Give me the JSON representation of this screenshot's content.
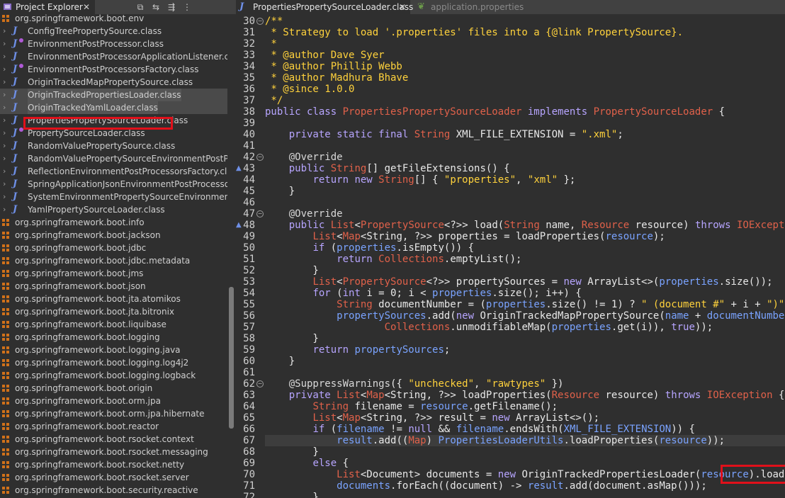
{
  "explorer": {
    "tab_label": "Project Explorer",
    "tab_close": "✕",
    "toolbar": [
      "⧉",
      "⇆",
      "⇶",
      "⋮"
    ],
    "rows": [
      {
        "kind": "pkg-cut",
        "label": "org.springframework.boot.env"
      },
      {
        "kind": "class",
        "label": "ConfigTreePropertySource.class"
      },
      {
        "kind": "class",
        "label": "EnvironmentPostProcessor.class",
        "overlay": true
      },
      {
        "kind": "class",
        "label": "EnvironmentPostProcessorApplicationListener.class"
      },
      {
        "kind": "class",
        "label": "EnvironmentPostProcessorsFactory.class",
        "overlay": true
      },
      {
        "kind": "class",
        "label": "OriginTrackedMapPropertySource.class"
      },
      {
        "kind": "class",
        "label": "OriginTrackedPropertiesLoader.class",
        "selected": true
      },
      {
        "kind": "class",
        "label": "OriginTrackedYamlLoader.class",
        "selected": true
      },
      {
        "kind": "class",
        "label": "PropertiesPropertySourceLoader.class"
      },
      {
        "kind": "class",
        "label": "PropertySourceLoader.class",
        "overlay": true
      },
      {
        "kind": "class",
        "label": "RandomValuePropertySource.class"
      },
      {
        "kind": "class",
        "label": "RandomValuePropertySourceEnvironmentPostProce"
      },
      {
        "kind": "class",
        "label": "ReflectionEnvironmentPostProcessorsFactory.class"
      },
      {
        "kind": "class",
        "label": "SpringApplicationJsonEnvironmentPostProcessor.cla"
      },
      {
        "kind": "class",
        "label": "SystemEnvironmentPropertySourceEnvironmentPost"
      },
      {
        "kind": "class",
        "label": "YamlPropertySourceLoader.class"
      },
      {
        "kind": "pkg",
        "label": "org.springframework.boot.info"
      },
      {
        "kind": "pkg",
        "label": "org.springframework.boot.jackson"
      },
      {
        "kind": "pkg",
        "label": "org.springframework.boot.jdbc"
      },
      {
        "kind": "pkg",
        "label": "org.springframework.boot.jdbc.metadata"
      },
      {
        "kind": "pkg",
        "label": "org.springframework.boot.jms"
      },
      {
        "kind": "pkg",
        "label": "org.springframework.boot.json"
      },
      {
        "kind": "pkg",
        "label": "org.springframework.boot.jta.atomikos"
      },
      {
        "kind": "pkg",
        "label": "org.springframework.boot.jta.bitronix"
      },
      {
        "kind": "pkg",
        "label": "org.springframework.boot.liquibase"
      },
      {
        "kind": "pkg",
        "label": "org.springframework.boot.logging"
      },
      {
        "kind": "pkg",
        "label": "org.springframework.boot.logging.java"
      },
      {
        "kind": "pkg",
        "label": "org.springframework.boot.logging.log4j2"
      },
      {
        "kind": "pkg",
        "label": "org.springframework.boot.logging.logback"
      },
      {
        "kind": "pkg",
        "label": "org.springframework.boot.origin"
      },
      {
        "kind": "pkg",
        "label": "org.springframework.boot.orm.jpa"
      },
      {
        "kind": "pkg",
        "label": "org.springframework.boot.orm.jpa.hibernate"
      },
      {
        "kind": "pkg",
        "label": "org.springframework.boot.reactor"
      },
      {
        "kind": "pkg",
        "label": "org.springframework.boot.rsocket.context"
      },
      {
        "kind": "pkg",
        "label": "org.springframework.boot.rsocket.messaging"
      },
      {
        "kind": "pkg",
        "label": "org.springframework.boot.rsocket.netty"
      },
      {
        "kind": "pkg",
        "label": "org.springframework.boot.rsocket.server"
      },
      {
        "kind": "pkg",
        "label": "org.springframework.boot.security.reactive"
      }
    ]
  },
  "editor": {
    "tabs": [
      {
        "label": "PropertiesPropertySourceLoader.class",
        "close": "✕",
        "icon": "J"
      },
      {
        "label": "application.properties",
        "icon": "❦"
      }
    ],
    "lines": [
      {
        "n": "30",
        "fold": "−",
        "segs": [
          [
            "c",
            "/**"
          ]
        ]
      },
      {
        "n": "31",
        "segs": [
          [
            "c",
            " * Strategy to load '.properties' files into a {@link PropertySource}."
          ]
        ]
      },
      {
        "n": "32",
        "segs": [
          [
            "c",
            " *"
          ]
        ]
      },
      {
        "n": "33",
        "segs": [
          [
            "c",
            " * @author Dave Syer"
          ]
        ]
      },
      {
        "n": "34",
        "segs": [
          [
            "c",
            " * @author Phillip Webb"
          ]
        ]
      },
      {
        "n": "35",
        "segs": [
          [
            "c",
            " * @author Madhura Bhave"
          ]
        ]
      },
      {
        "n": "36",
        "segs": [
          [
            "c",
            " * @since 1.0.0"
          ]
        ]
      },
      {
        "n": "37",
        "segs": [
          [
            "c",
            " */"
          ]
        ]
      },
      {
        "n": "38",
        "segs": [
          [
            "kw",
            "public class "
          ],
          [
            "t",
            "PropertiesPropertySourceLoader"
          ],
          [
            "kw",
            " implements "
          ],
          [
            "t",
            "PropertySourceLoader"
          ],
          [
            "a",
            " {"
          ]
        ]
      },
      {
        "n": "39",
        "segs": []
      },
      {
        "n": "40",
        "segs": [
          [
            "a",
            "    "
          ],
          [
            "kw",
            "private static final "
          ],
          [
            "t",
            "String"
          ],
          [
            "a",
            " XML_FILE_EXTENSION = "
          ],
          [
            "s",
            "\".xml\""
          ],
          [
            "a",
            ";"
          ]
        ]
      },
      {
        "n": "41",
        "segs": []
      },
      {
        "n": "42",
        "fold": "−",
        "segs": [
          [
            "a",
            "    "
          ],
          [
            "an",
            "@Override"
          ]
        ]
      },
      {
        "n": "43",
        "ovr": true,
        "segs": [
          [
            "a",
            "    "
          ],
          [
            "kw",
            "public "
          ],
          [
            "t",
            "String"
          ],
          [
            "a",
            "[] getFileExtensions() {"
          ]
        ]
      },
      {
        "n": "44",
        "segs": [
          [
            "a",
            "        "
          ],
          [
            "kw",
            "return new "
          ],
          [
            "t",
            "String"
          ],
          [
            "a",
            "[] { "
          ],
          [
            "s",
            "\"properties\""
          ],
          [
            "a",
            ", "
          ],
          [
            "s",
            "\"xml\""
          ],
          [
            "a",
            " };"
          ]
        ]
      },
      {
        "n": "45",
        "segs": [
          [
            "a",
            "    }"
          ]
        ]
      },
      {
        "n": "46",
        "segs": []
      },
      {
        "n": "47",
        "fold": "−",
        "segs": [
          [
            "a",
            "    "
          ],
          [
            "an",
            "@Override"
          ]
        ]
      },
      {
        "n": "48",
        "ovr": true,
        "segs": [
          [
            "a",
            "    "
          ],
          [
            "kw",
            "public "
          ],
          [
            "t",
            "List"
          ],
          [
            "a",
            "<"
          ],
          [
            "t",
            "PropertySource"
          ],
          [
            "a",
            "<?>> load("
          ],
          [
            "t",
            "String"
          ],
          [
            "a",
            " name, "
          ],
          [
            "t",
            "Resource"
          ],
          [
            "a",
            " resource) "
          ],
          [
            "kw",
            "throws "
          ],
          [
            "t",
            "IOException"
          ],
          [
            "a",
            " {"
          ]
        ]
      },
      {
        "n": "49",
        "segs": [
          [
            "a",
            "        "
          ],
          [
            "t",
            "List"
          ],
          [
            "a",
            "<"
          ],
          [
            "t",
            "Map"
          ],
          [
            "a",
            "<String, ?>> properties = loadProperties("
          ],
          [
            "v",
            "resource"
          ],
          [
            "a",
            ");"
          ]
        ]
      },
      {
        "n": "50",
        "segs": [
          [
            "a",
            "        "
          ],
          [
            "kw",
            "if "
          ],
          [
            "a",
            "("
          ],
          [
            "v",
            "properties"
          ],
          [
            "a",
            ".isEmpty()) {"
          ]
        ]
      },
      {
        "n": "51",
        "segs": [
          [
            "a",
            "            "
          ],
          [
            "kw",
            "return "
          ],
          [
            "t",
            "Collections"
          ],
          [
            "a",
            ".emptyList();"
          ]
        ]
      },
      {
        "n": "52",
        "segs": [
          [
            "a",
            "        }"
          ]
        ]
      },
      {
        "n": "53",
        "segs": [
          [
            "a",
            "        "
          ],
          [
            "t",
            "List"
          ],
          [
            "a",
            "<"
          ],
          [
            "t",
            "PropertySource"
          ],
          [
            "a",
            "<?>> propertySources = "
          ],
          [
            "kw",
            "new "
          ],
          [
            "a",
            "ArrayList<>("
          ],
          [
            "v",
            "properties"
          ],
          [
            "a",
            ".size());"
          ]
        ]
      },
      {
        "n": "54",
        "segs": [
          [
            "a",
            "        "
          ],
          [
            "kw",
            "for "
          ],
          [
            "a",
            "("
          ],
          [
            "kw",
            "int "
          ],
          [
            "a",
            "i = 0; i < "
          ],
          [
            "v",
            "properties"
          ],
          [
            "a",
            ".size(); i++) {"
          ]
        ]
      },
      {
        "n": "55",
        "segs": [
          [
            "a",
            "            "
          ],
          [
            "t",
            "String"
          ],
          [
            "a",
            " documentNumber = ("
          ],
          [
            "v",
            "properties"
          ],
          [
            "a",
            ".size() != 1) ? "
          ],
          [
            "s",
            "\" (document #\""
          ],
          [
            "a",
            " + i + "
          ],
          [
            "s",
            "\")\""
          ],
          [
            "a",
            " : "
          ],
          [
            "s",
            "\"\""
          ]
        ]
      },
      {
        "n": "56",
        "segs": [
          [
            "a",
            "            "
          ],
          [
            "v",
            "propertySources"
          ],
          [
            "a",
            ".add("
          ],
          [
            "kw",
            "new "
          ],
          [
            "a",
            "OriginTrackedMapPropertySource("
          ],
          [
            "v",
            "name"
          ],
          [
            "a",
            " + "
          ],
          [
            "v",
            "documentNumber"
          ],
          [
            "a",
            ","
          ]
        ]
      },
      {
        "n": "57",
        "segs": [
          [
            "a",
            "                    "
          ],
          [
            "t",
            "Collections"
          ],
          [
            "a",
            ".unmodifiableMap("
          ],
          [
            "v",
            "properties"
          ],
          [
            "a",
            ".get(i)), "
          ],
          [
            "kw",
            "true"
          ],
          [
            "a",
            "));"
          ]
        ]
      },
      {
        "n": "58",
        "segs": [
          [
            "a",
            "        }"
          ]
        ]
      },
      {
        "n": "59",
        "segs": [
          [
            "a",
            "        "
          ],
          [
            "kw",
            "return "
          ],
          [
            "v",
            "propertySources"
          ],
          [
            "a",
            ";"
          ]
        ]
      },
      {
        "n": "60",
        "segs": [
          [
            "a",
            "    }"
          ]
        ]
      },
      {
        "n": "61",
        "segs": []
      },
      {
        "n": "62",
        "fold": "−",
        "segs": [
          [
            "a",
            "    "
          ],
          [
            "an",
            "@SuppressWarnings"
          ],
          [
            "a",
            "({ "
          ],
          [
            "s",
            "\"unchecked\""
          ],
          [
            "a",
            ", "
          ],
          [
            "s",
            "\"rawtypes\""
          ],
          [
            "a",
            " })"
          ]
        ]
      },
      {
        "n": "63",
        "segs": [
          [
            "a",
            "    "
          ],
          [
            "kw",
            "private "
          ],
          [
            "t",
            "List"
          ],
          [
            "a",
            "<"
          ],
          [
            "t",
            "Map"
          ],
          [
            "a",
            "<String, ?>> loadProperties("
          ],
          [
            "t",
            "Resource"
          ],
          [
            "a",
            " resource) "
          ],
          [
            "kw",
            "throws "
          ],
          [
            "t",
            "IOException"
          ],
          [
            "a",
            " {"
          ]
        ]
      },
      {
        "n": "64",
        "segs": [
          [
            "a",
            "        "
          ],
          [
            "t",
            "String"
          ],
          [
            "a",
            " filename = "
          ],
          [
            "v",
            "resource"
          ],
          [
            "a",
            ".getFilename();"
          ]
        ]
      },
      {
        "n": "65",
        "segs": [
          [
            "a",
            "        "
          ],
          [
            "t",
            "List"
          ],
          [
            "a",
            "<"
          ],
          [
            "t",
            "Map"
          ],
          [
            "a",
            "<String, ?>> result = "
          ],
          [
            "kw",
            "new "
          ],
          [
            "a",
            "ArrayList<>();"
          ]
        ]
      },
      {
        "n": "66",
        "segs": [
          [
            "a",
            "        "
          ],
          [
            "kw",
            "if "
          ],
          [
            "a",
            "("
          ],
          [
            "v",
            "filename"
          ],
          [
            "a",
            " != "
          ],
          [
            "kw",
            "null "
          ],
          [
            "a",
            "&& "
          ],
          [
            "v",
            "filename"
          ],
          [
            "a",
            ".endsWith("
          ],
          [
            "v",
            "XML_FILE_EXTENSION"
          ],
          [
            "a",
            ")) {"
          ]
        ]
      },
      {
        "n": "67",
        "cur": true,
        "segs": [
          [
            "a",
            "            "
          ],
          [
            "v",
            "result"
          ],
          [
            "a",
            ".add(("
          ],
          [
            "t",
            "Map"
          ],
          [
            "a",
            ") "
          ],
          [
            "v",
            "PropertiesLoaderUtils"
          ],
          [
            "a",
            ".loadProperties("
          ],
          [
            "v",
            "resource"
          ],
          [
            "a",
            "));"
          ]
        ]
      },
      {
        "n": "68",
        "segs": [
          [
            "a",
            "        }"
          ]
        ]
      },
      {
        "n": "69",
        "segs": [
          [
            "a",
            "        "
          ],
          [
            "kw",
            "else "
          ],
          [
            "a",
            "{"
          ]
        ]
      },
      {
        "n": "70",
        "segs": [
          [
            "a",
            "            "
          ],
          [
            "t",
            "List"
          ],
          [
            "a",
            "<Document> documents = "
          ],
          [
            "kw",
            "new "
          ],
          [
            "a",
            "OriginTrackedPropertiesLoader("
          ],
          [
            "v",
            "resource"
          ],
          [
            "a",
            ").load();"
          ]
        ]
      },
      {
        "n": "71",
        "segs": [
          [
            "a",
            "            "
          ],
          [
            "v",
            "documents"
          ],
          [
            "a",
            ".forEach((document) -> "
          ],
          [
            "v",
            "result"
          ],
          [
            "a",
            ".add(document.asMap()));"
          ]
        ]
      },
      {
        "n": "72",
        "segs": [
          [
            "a",
            "        }"
          ]
        ]
      }
    ]
  },
  "colors": {
    "background": "#2f2f2f",
    "tabbar": "#414141",
    "highlight_box": "#e0101a"
  }
}
